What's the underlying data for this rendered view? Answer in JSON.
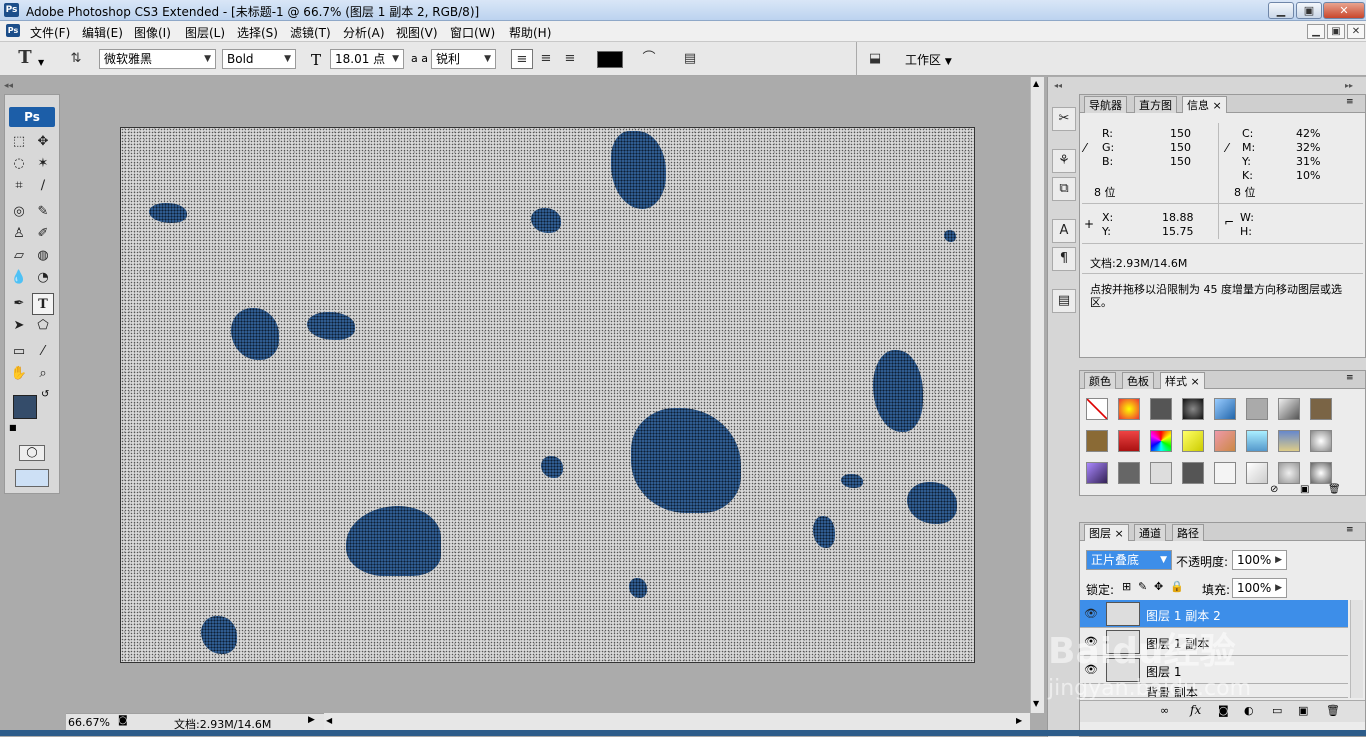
{
  "app": {
    "title": "Adobe Photoshop CS3 Extended - [未标题-1 @ 66.7% (图层 1 副本 2, RGB/8)]",
    "badge": "Ps"
  },
  "window_buttons": {
    "minimize": "▁",
    "maximize": "▣",
    "close": "✕"
  },
  "menus": [
    "文件(F)",
    "编辑(E)",
    "图像(I)",
    "图层(L)",
    "选择(S)",
    "滤镜(T)",
    "分析(A)",
    "视图(V)",
    "窗口(W)",
    "帮助(H)"
  ],
  "options": {
    "tool_glyph": "T",
    "font_family": "微软雅黑",
    "font_style": "Bold",
    "font_size": "18.01 点",
    "aa_label": "a a",
    "antialias": "锐利",
    "workspace": "工作区"
  },
  "toolbox": {
    "badge": "Ps"
  },
  "status": {
    "zoom": "66.67%",
    "doc": "文档:2.93M/14.6M"
  },
  "info_panel": {
    "tabs": [
      "导航器",
      "直方图",
      "信息"
    ],
    "rgb": [
      {
        "k": "R:",
        "v": "150"
      },
      {
        "k": "G:",
        "v": "150"
      },
      {
        "k": "B:",
        "v": "150"
      }
    ],
    "cmyk": [
      {
        "k": "C:",
        "v": "42%"
      },
      {
        "k": "M:",
        "v": "32%"
      },
      {
        "k": "Y:",
        "v": "31%"
      },
      {
        "k": "K:",
        "v": "10%"
      }
    ],
    "bits_left": "8 位",
    "bits_right": "8 位",
    "x_label": "X:",
    "x_value": "18.88",
    "y_label": "Y:",
    "y_value": "15.75",
    "w_label": "W:",
    "h_label": "H:",
    "doc": "文档:2.93M/14.6M",
    "hint": "点按并拖移以沿限制为 45 度增量方向移动图层或选区。"
  },
  "styles_panel": {
    "tabs": [
      "颜色",
      "色板",
      "样式"
    ]
  },
  "layers_panel": {
    "tabs": [
      "图层",
      "通道",
      "路径"
    ],
    "blend_mode": "正片叠底",
    "opacity_label": "不透明度:",
    "opacity": "100%",
    "lock_label": "锁定:",
    "fill_label": "填充:",
    "fill": "100%",
    "layers": [
      {
        "name": "图层 1 副本 2",
        "selected": true
      },
      {
        "name": "图层 1 副本",
        "selected": false
      },
      {
        "name": "图层 1",
        "selected": false
      },
      {
        "name": "背景 副本",
        "selected": false
      }
    ]
  },
  "watermark": {
    "line1": "Baidu经验",
    "line2": "jingyan.baidu.com"
  },
  "colors": {
    "foreground": "#344c6a",
    "background": "#ffffff",
    "accent": "#3d8ee9",
    "blob": "#2f5b8f"
  }
}
